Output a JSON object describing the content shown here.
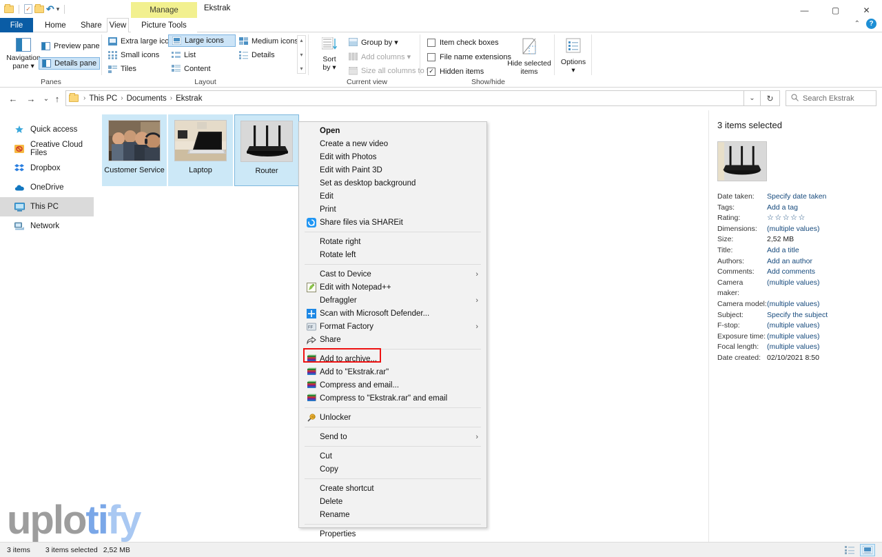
{
  "window": {
    "context_tab": "Manage",
    "title": "Ekstrak",
    "minimize": "—",
    "maximize": "▢",
    "close": "✕",
    "collapse_ribbon": "⌃",
    "help": "?"
  },
  "quick_access": {
    "new_folder_icon": "folder-icon",
    "properties_icon": "properties-icon",
    "folder_icon": "folder-icon",
    "undo_icon": "undo-icon",
    "customize_icon": "chevron-down-icon"
  },
  "tabs": [
    {
      "label": "File",
      "active": false
    },
    {
      "label": "Home",
      "active": false
    },
    {
      "label": "Share",
      "active": false
    },
    {
      "label": "View",
      "active": true
    },
    {
      "label": "Picture Tools",
      "active": false
    }
  ],
  "ribbon": {
    "groups": [
      {
        "name": "Panes",
        "label": "Panes",
        "big_button": {
          "label_line1": "Navigation",
          "label_line2": "pane ▾",
          "icon": "navigation-pane-icon"
        },
        "small_buttons": [
          {
            "label": "Preview pane",
            "selected": false,
            "icon": "preview-pane-icon"
          },
          {
            "label": "Details pane",
            "selected": true,
            "icon": "details-pane-icon"
          }
        ]
      },
      {
        "name": "Layout",
        "label": "Layout",
        "items": [
          {
            "label": "Extra large icons",
            "selected": false
          },
          {
            "label": "Large icons",
            "selected": true
          },
          {
            "label": "Medium icons",
            "selected": false
          },
          {
            "label": "Small icons",
            "selected": false
          },
          {
            "label": "List",
            "selected": false
          },
          {
            "label": "Details",
            "selected": false
          },
          {
            "label": "Tiles",
            "selected": false
          },
          {
            "label": "Content",
            "selected": false
          }
        ],
        "scroll_up": "▴",
        "scroll_down": "▾",
        "scroll_more": "▾"
      },
      {
        "name": "Current view",
        "label": "Current view",
        "sort_by": {
          "label_line1": "Sort",
          "label_line2": "by ▾",
          "icon": "sort-icon"
        },
        "small_buttons": [
          {
            "label": "Group by ▾",
            "disabled": false,
            "icon": "group-by-icon"
          },
          {
            "label": "Add columns ▾",
            "disabled": true,
            "icon": "add-columns-icon"
          },
          {
            "label": "Size all columns to fit",
            "disabled": true,
            "icon": "size-columns-icon"
          }
        ]
      },
      {
        "name": "Show/hide",
        "label": "Show/hide",
        "checkboxes": [
          {
            "label": "Item check boxes",
            "checked": false
          },
          {
            "label": "File name extensions",
            "checked": false
          },
          {
            "label": "Hidden items",
            "checked": true
          }
        ],
        "hide_selected": {
          "label_line1": "Hide selected",
          "label_line2": "items",
          "icon": "hide-selected-icon"
        }
      },
      {
        "name": "Options",
        "label": "",
        "options": {
          "label_line1": "Options",
          "label_line2": "▾",
          "icon": "options-icon"
        }
      }
    ]
  },
  "address_bar": {
    "back": "←",
    "forward": "→",
    "recent": "⌄",
    "up": "↑",
    "crumbs": [
      "This PC",
      "Documents",
      "Ekstrak"
    ],
    "separator": "›",
    "dropdown": "⌄",
    "refresh": "↻"
  },
  "search": {
    "placeholder": "Search Ekstrak",
    "icon": "search-icon"
  },
  "sidebar": {
    "items": [
      {
        "label": "Quick access",
        "icon": "star-icon",
        "selected": false
      },
      {
        "label": "Creative Cloud Files",
        "icon": "creative-cloud-icon",
        "selected": false
      },
      {
        "label": "Dropbox",
        "icon": "dropbox-icon",
        "selected": false
      },
      {
        "label": "OneDrive",
        "icon": "onedrive-icon",
        "selected": false
      },
      {
        "label": "This PC",
        "icon": "this-pc-icon",
        "selected": true
      },
      {
        "label": "Network",
        "icon": "network-icon",
        "selected": false
      }
    ]
  },
  "files": [
    {
      "name": "Customer Service",
      "selected": true,
      "focused": false,
      "thumb": "people-photo"
    },
    {
      "name": "Laptop",
      "selected": true,
      "focused": false,
      "thumb": "laptop-photo"
    },
    {
      "name": "Router",
      "selected": true,
      "focused": true,
      "thumb": "router-photo"
    }
  ],
  "context_menu": {
    "items": [
      {
        "label": "Open",
        "bold": true,
        "icon": null,
        "submenu": false
      },
      {
        "label": "Create a new video",
        "bold": false,
        "icon": null,
        "submenu": false
      },
      {
        "label": "Edit with Photos",
        "bold": false,
        "icon": null,
        "submenu": false
      },
      {
        "label": "Edit with Paint 3D",
        "bold": false,
        "icon": null,
        "submenu": false
      },
      {
        "label": "Set as desktop background",
        "bold": false,
        "icon": null,
        "submenu": false
      },
      {
        "label": "Edit",
        "bold": false,
        "icon": null,
        "submenu": false
      },
      {
        "label": "Print",
        "bold": false,
        "icon": null,
        "submenu": false
      },
      {
        "label": "Share files via SHAREit",
        "bold": false,
        "icon": "shareit-icon",
        "submenu": false
      },
      {
        "separator": true
      },
      {
        "label": "Rotate right",
        "bold": false,
        "icon": null,
        "submenu": false
      },
      {
        "label": "Rotate left",
        "bold": false,
        "icon": null,
        "submenu": false
      },
      {
        "separator": true
      },
      {
        "label": "Cast to Device",
        "bold": false,
        "icon": null,
        "submenu": true
      },
      {
        "label": "Edit with Notepad++",
        "bold": false,
        "icon": "notepadpp-icon",
        "submenu": false
      },
      {
        "label": "Defraggler",
        "bold": false,
        "icon": null,
        "submenu": true
      },
      {
        "label": "Scan with Microsoft Defender...",
        "bold": false,
        "icon": "defender-icon",
        "submenu": false
      },
      {
        "label": "Format Factory",
        "bold": false,
        "icon": "format-factory-icon",
        "submenu": true
      },
      {
        "label": "Share",
        "bold": false,
        "icon": "share-icon",
        "submenu": false
      },
      {
        "separator": true
      },
      {
        "label": "Add to archive...",
        "bold": false,
        "icon": "winrar-icon",
        "submenu": false,
        "highlighted": true
      },
      {
        "label": "Add to \"Ekstrak.rar\"",
        "bold": false,
        "icon": "winrar-icon",
        "submenu": false
      },
      {
        "label": "Compress and email...",
        "bold": false,
        "icon": "winrar-icon",
        "submenu": false
      },
      {
        "label": "Compress to \"Ekstrak.rar\" and email",
        "bold": false,
        "icon": "winrar-icon",
        "submenu": false
      },
      {
        "separator": true
      },
      {
        "label": "Unlocker",
        "bold": false,
        "icon": "unlocker-icon",
        "submenu": false
      },
      {
        "separator": true
      },
      {
        "label": "Send to",
        "bold": false,
        "icon": null,
        "submenu": true
      },
      {
        "separator": true
      },
      {
        "label": "Cut",
        "bold": false,
        "icon": null,
        "submenu": false
      },
      {
        "label": "Copy",
        "bold": false,
        "icon": null,
        "submenu": false
      },
      {
        "separator": true
      },
      {
        "label": "Create shortcut",
        "bold": false,
        "icon": null,
        "submenu": false
      },
      {
        "label": "Delete",
        "bold": false,
        "icon": null,
        "submenu": false
      },
      {
        "label": "Rename",
        "bold": false,
        "icon": null,
        "submenu": false
      },
      {
        "separator": true
      },
      {
        "label": "Properties",
        "bold": false,
        "icon": null,
        "submenu": false
      }
    ],
    "submenu_arrow": "›",
    "highlight_color": "#ee1111"
  },
  "details_pane": {
    "heading": "3 items selected",
    "thumbnail": "router-photo",
    "properties": [
      {
        "key": "Date taken:",
        "value": "Specify date taken",
        "link": true
      },
      {
        "key": "Tags:",
        "value": "Add a tag",
        "link": true
      },
      {
        "key": "Rating:",
        "value": "☆☆☆☆☆",
        "stars": true
      },
      {
        "key": "Dimensions:",
        "value": "(multiple values)",
        "link": true
      },
      {
        "key": "Size:",
        "value": "2,52 MB",
        "link": false
      },
      {
        "key": "Title:",
        "value": "Add a title",
        "link": true
      },
      {
        "key": "Authors:",
        "value": "Add an author",
        "link": true
      },
      {
        "key": "Comments:",
        "value": "Add comments",
        "link": true
      },
      {
        "key": "Camera maker:",
        "value": "(multiple values)",
        "link": true
      },
      {
        "key": "Camera model:",
        "value": "(multiple values)",
        "link": true
      },
      {
        "key": "Subject:",
        "value": "Specify the subject",
        "link": true
      },
      {
        "key": "F-stop:",
        "value": "(multiple values)",
        "link": true
      },
      {
        "key": "Exposure time:",
        "value": "(multiple values)",
        "link": true
      },
      {
        "key": "Focal length:",
        "value": "(multiple values)",
        "link": true
      },
      {
        "key": "Date created:",
        "value": "02/10/2021 8:50",
        "link": false
      }
    ]
  },
  "status_bar": {
    "item_count": "3 items",
    "selection": "3 items selected",
    "size": "2,52 MB",
    "details_view_icon": "details-view-icon",
    "large_icons_view_icon": "large-icons-view-icon"
  },
  "watermark": {
    "part1": "uplo",
    "part2": "ti",
    "part3": "fy"
  }
}
